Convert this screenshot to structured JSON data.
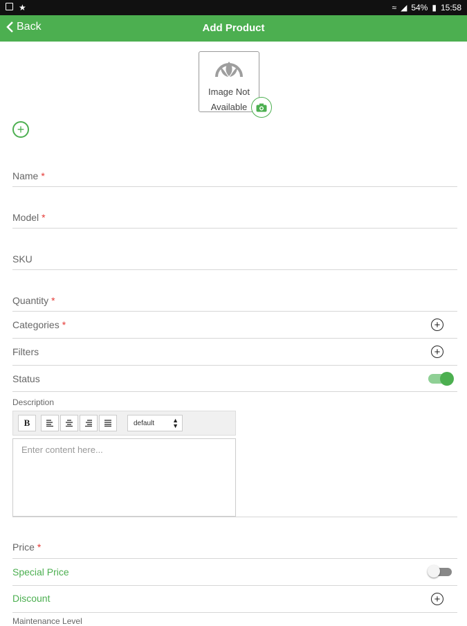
{
  "status_bar": {
    "battery": "54%",
    "time": "15:58"
  },
  "header": {
    "back_label": "Back",
    "title": "Add Product"
  },
  "image": {
    "line1": "Image Not",
    "line2": "Available"
  },
  "fields": {
    "name": "Name",
    "model": "Model",
    "sku": "SKU",
    "quantity": "Quantity",
    "categories": "Categories",
    "filters": "Filters",
    "status": "Status",
    "price": "Price",
    "special_price": "Special Price",
    "discount": "Discount",
    "maintenance_level": "Maintenance Level"
  },
  "required_marker": "*",
  "plus_symbol": "+",
  "status_toggle_on": true,
  "special_price_toggle_on": false,
  "description": {
    "label": "Description",
    "placeholder": "Enter content here...",
    "bold_label": "B",
    "font_size_selected": "default"
  },
  "colors": {
    "accent": "#4caf50",
    "required": "#e53935"
  }
}
